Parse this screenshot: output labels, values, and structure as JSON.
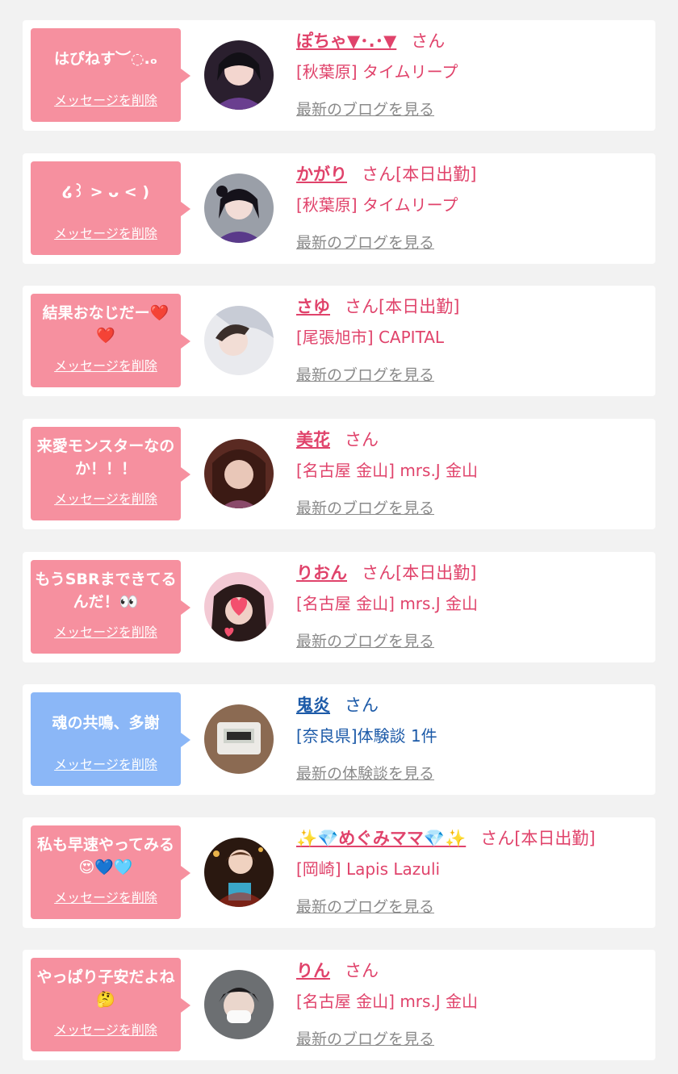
{
  "colors": {
    "pink_bubble": "#f6909f",
    "blue_bubble": "#8bb7f7",
    "pink_text": "#e0436b",
    "blue_text": "#1c5aa8",
    "link_gray": "#8a8a8a"
  },
  "delete_label": "メッセージを削除",
  "entries": [
    {
      "message": "はぴねす︶◌.ₒ",
      "name": "ぽちゃ▼･.･▼",
      "suffix": "さん",
      "shop": "[秋葉原] タイムリープ",
      "link": "最新のブログを見る",
      "theme": "pink"
    },
    {
      "message": "໒꒱ > ᴗ < )",
      "name": "かがり",
      "suffix": "さん[本日出勤]",
      "shop": "[秋葉原] タイムリープ",
      "link": "最新のブログを見る",
      "theme": "pink"
    },
    {
      "message": "結果おなじだー❤️❤️",
      "name": "さゆ",
      "suffix": "さん[本日出勤]",
      "shop": "[尾張旭市] CAPITAL",
      "link": "最新のブログを見る",
      "theme": "pink"
    },
    {
      "message": "来愛モンスターなのか！！！",
      "name": "美花",
      "suffix": "さん",
      "shop": "[名古屋 金山] mrs.J 金山",
      "link": "最新のブログを見る",
      "theme": "pink"
    },
    {
      "message": "もうSBRまできてるんだ！👀",
      "name": "りおん",
      "suffix": "さん[本日出勤]",
      "shop": "[名古屋 金山] mrs.J 金山",
      "link": "最新のブログを見る",
      "theme": "pink"
    },
    {
      "message": "魂の共鳴、多謝",
      "name": "鬼炎",
      "suffix": "さん",
      "shop": "[奈良県]体験談 1件",
      "link": "最新の体験談を見る",
      "theme": "blue"
    },
    {
      "message": "私も早速やってみる😍💙🩵",
      "name": "✨💎めぐみママ💎✨",
      "suffix": "さん[本日出勤]",
      "shop": "[岡崎] Lapis Lazuli",
      "link": "最新のブログを見る",
      "theme": "pink"
    },
    {
      "message": "やっぱり子安だよね🤔",
      "name": "りん",
      "suffix": "さん",
      "shop": "[名古屋 金山] mrs.J 金山",
      "link": "最新のブログを見る",
      "theme": "pink"
    }
  ]
}
